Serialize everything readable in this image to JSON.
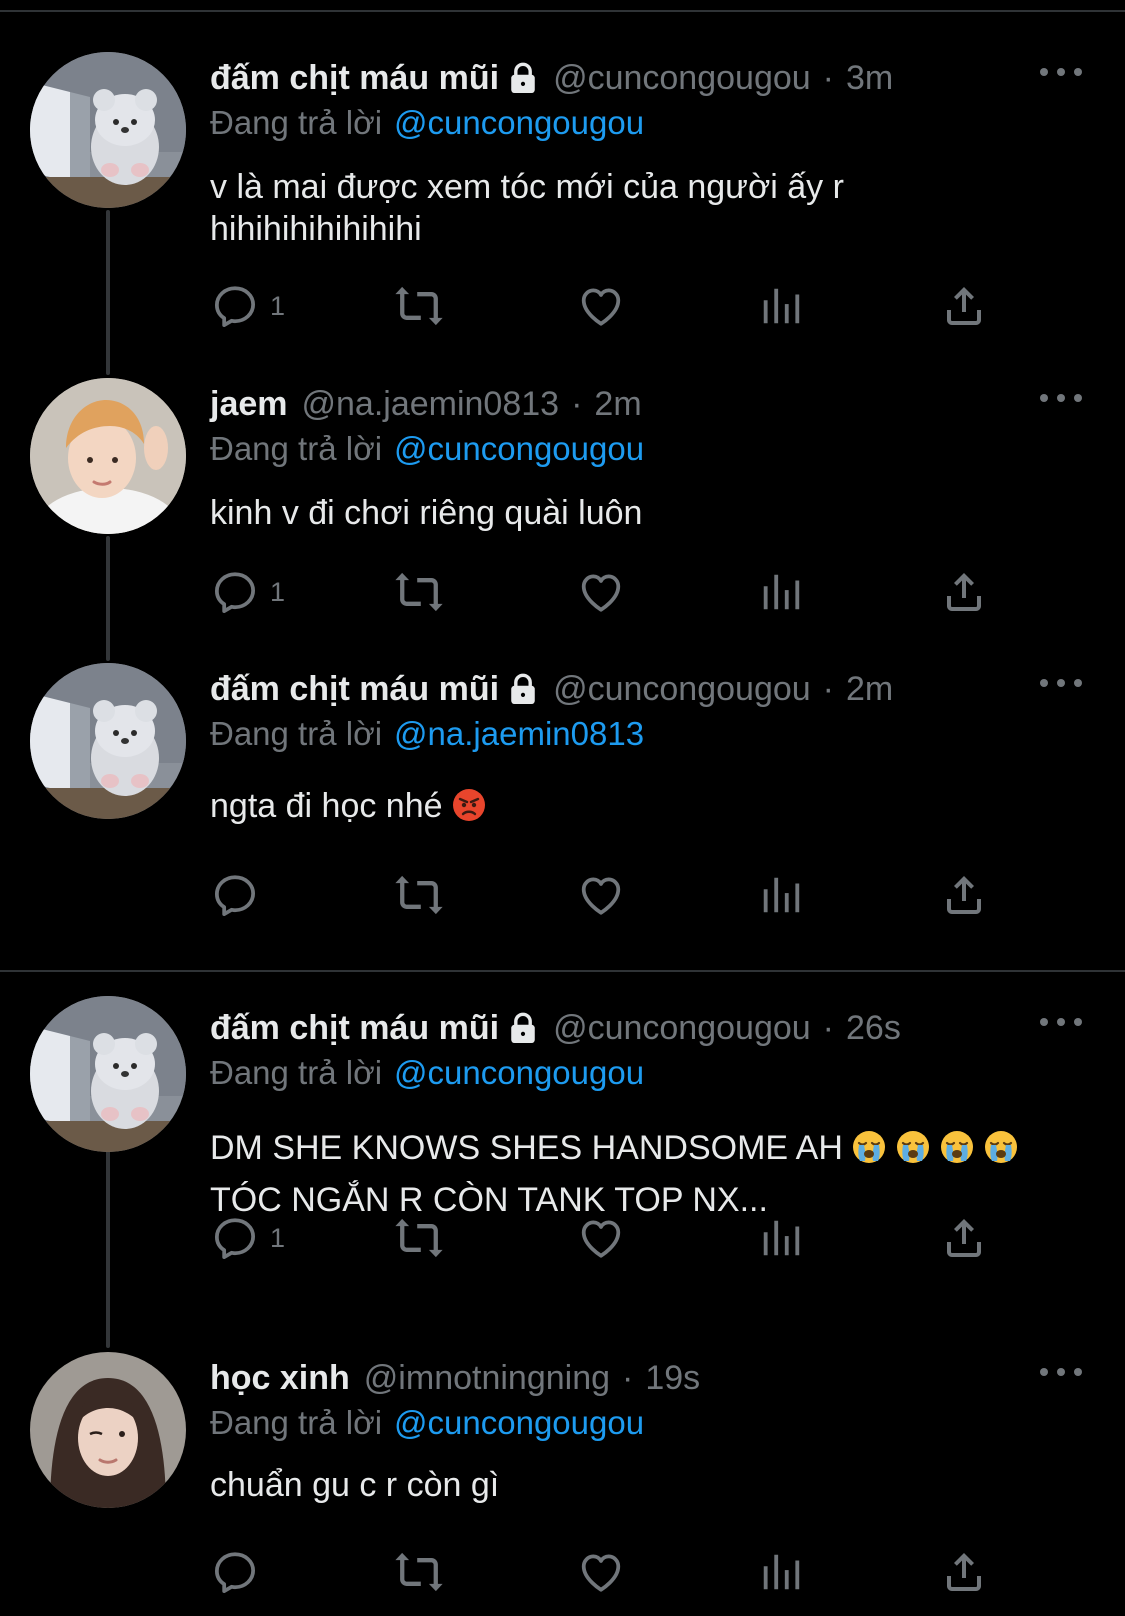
{
  "tweets": [
    {
      "display_name": "đấm chịt máu mũi",
      "locked": true,
      "handle": "@cuncongougou",
      "time": "3m",
      "reply_prefix": "Đang trả lời",
      "reply_target": "@cuncongougou",
      "body_lines": [
        "v là mai được xem tóc mới của người ấy r",
        "hihihihihihihihi"
      ],
      "reply_count": "1",
      "avatar": "plush-bear-avatar"
    },
    {
      "display_name": "jaem",
      "locked": false,
      "handle": "@na.jaemin0813",
      "time": "2m",
      "reply_prefix": "Đang trả lời",
      "reply_target": "@cuncongougou",
      "body_lines": [
        "kinh v đi chơi riêng quài luôn"
      ],
      "reply_count": "1",
      "avatar": "person-avatar"
    },
    {
      "display_name": "đấm chịt máu mũi",
      "locked": true,
      "handle": "@cuncongougou",
      "time": "2m",
      "reply_prefix": "Đang trả lời",
      "reply_target": "@na.jaemin0813",
      "body_lines": [
        "ngta đi học nhé"
      ],
      "body_emoji": "angry-face-emoji",
      "reply_count": "",
      "avatar": "plush-bear-avatar"
    },
    {
      "display_name": "đấm chịt máu mũi",
      "locked": true,
      "handle": "@cuncongougou",
      "time": "26s",
      "reply_prefix": "Đang trả lời",
      "reply_target": "@cuncongougou",
      "body_lines": [
        "DM SHE KNOWS SHES HANDSOME AH",
        "TÓC NGẮN R CÒN TANK TOP NX..."
      ],
      "body_emoji": "loudly-crying-face-emoji",
      "body_emoji_count": 4,
      "reply_count": "1",
      "avatar": "plush-bear-avatar"
    },
    {
      "display_name": "học xinh",
      "locked": false,
      "handle": "@imnotningning",
      "time": "19s",
      "reply_prefix": "Đang trả lời",
      "reply_target": "@cuncongougou",
      "body_lines": [
        "chuẩn gu c r còn gì"
      ],
      "reply_count": "",
      "avatar": "person-avatar"
    }
  ],
  "separator": "·",
  "icons": {
    "reply": "reply-icon",
    "retweet": "retweet-icon",
    "like": "heart-icon",
    "views": "views-icon",
    "share": "share-icon",
    "more": "more-icon",
    "lock": "lock-icon"
  },
  "colors": {
    "background": "#000000",
    "text": "#e7e9ea",
    "muted": "#71767b",
    "link": "#1d9bf0",
    "divider": "#2f3336"
  }
}
